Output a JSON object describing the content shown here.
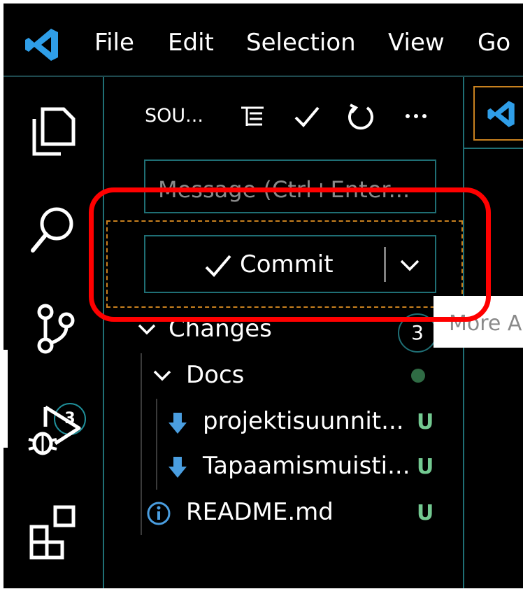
{
  "menu": [
    "File",
    "Edit",
    "Selection",
    "View",
    "Go"
  ],
  "activity": {
    "source_control_badge": "3"
  },
  "scm": {
    "title": "SOU...",
    "message_placeholder": "Message (Ctrl+Enter...",
    "commit_label": "Commit",
    "changes_label": "Changes",
    "changes_count": "3",
    "folder": "Docs",
    "files": [
      {
        "name": "projektisuunnit...",
        "status": "U"
      },
      {
        "name": "Tapaamismuisti...",
        "status": "U"
      },
      {
        "name": "README.md",
        "status": "U"
      }
    ]
  },
  "tooltip": "More A",
  "colors": {
    "accent_teal": "#1f6f75",
    "focus_orange": "#c9811f",
    "untracked_green": "#73c991",
    "highlight_red": "#ff0000",
    "vscode_blue": "#2f9ee8"
  }
}
